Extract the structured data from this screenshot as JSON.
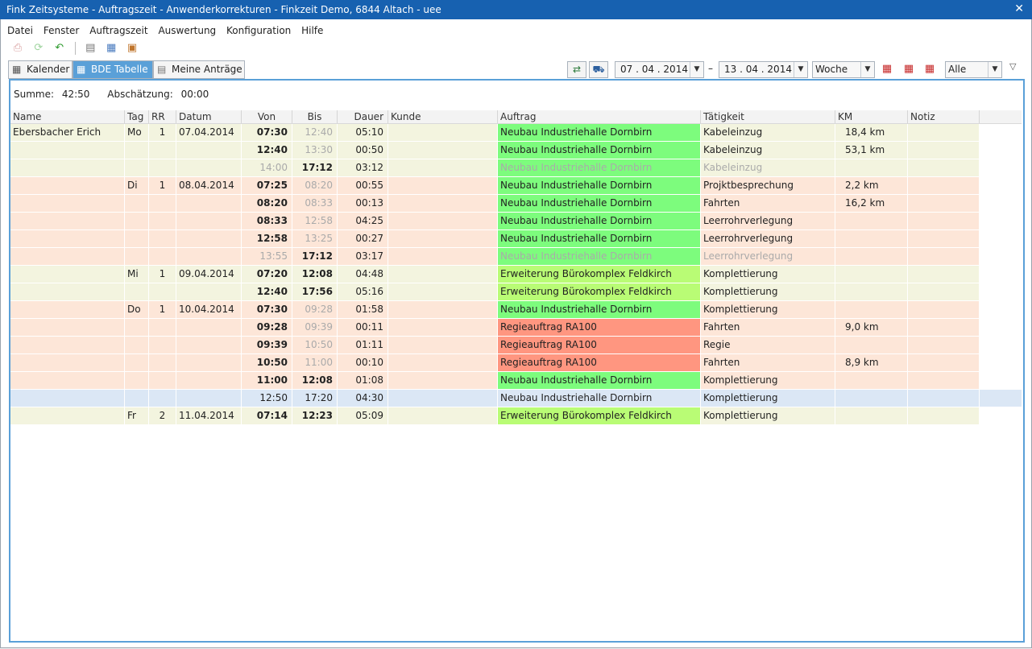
{
  "window": {
    "title": "Fink Zeitsysteme - Auftragszeit - Anwenderkorrekturen - Finkzeit Demo, 6844 Altach - uee",
    "close": "✕"
  },
  "menu": [
    "Datei",
    "Fenster",
    "Auftragszeit",
    "Auswertung",
    "Konfiguration",
    "Hilfe"
  ],
  "tabs": [
    {
      "label": "Kalender",
      "icon": "calendar-icon"
    },
    {
      "label": "BDE Tabelle",
      "icon": "table-icon"
    },
    {
      "label": "Meine Anträge",
      "icon": "document-icon"
    }
  ],
  "filter": {
    "date_from": "07 . 04 . 2014",
    "range_sep": "–",
    "date_to": "13 . 04 . 2014",
    "period": "Woche",
    "scope": "Alle"
  },
  "summary": {
    "sum_label": "Summe:",
    "sum_value": "42:50",
    "est_label": "Abschätzung:",
    "est_value": "00:00"
  },
  "columns": [
    "Name",
    "Tag",
    "RR",
    "Datum",
    "Von",
    "Bis",
    "Dauer",
    "Kunde",
    "Auftrag",
    "Tätigkeit",
    "KM",
    "Notiz"
  ],
  "colors": {
    "day_light": "#f3f4df",
    "day_peach": "#fde6d8",
    "order_green": "#7dfc7d",
    "order_lime": "#b9fc75",
    "order_red": "#ff9680",
    "selected": "#dbe7f5",
    "accent": "#5aa0d8"
  },
  "rows": [
    {
      "name": "Ebersbacher Erich",
      "tag": "Mo",
      "rr": "1",
      "datum": "07.04.2014",
      "von": "07:30",
      "bis": "12:40",
      "dauer": "05:10",
      "kunde": "",
      "auftrag": "Neubau Industriehalle Dornbirn",
      "taetigkeit": "Kabeleinzug",
      "km": "18,4 km",
      "notiz": "",
      "band": "light",
      "ac": "green",
      "vs": "b",
      "bs": "g",
      "fade": false
    },
    {
      "name": "",
      "tag": "",
      "rr": "",
      "datum": "",
      "von": "12:40",
      "bis": "13:30",
      "dauer": "00:50",
      "kunde": "",
      "auftrag": "Neubau Industriehalle Dornbirn",
      "taetigkeit": "Kabeleinzug",
      "km": "53,1 km",
      "notiz": "",
      "band": "light",
      "ac": "green",
      "vs": "b",
      "bs": "g",
      "fade": false
    },
    {
      "name": "",
      "tag": "",
      "rr": "",
      "datum": "",
      "von": "14:00",
      "bis": "17:12",
      "dauer": "03:12",
      "kunde": "",
      "auftrag": "Neubau Industriehalle Dornbirn",
      "taetigkeit": "Kabeleinzug",
      "km": "",
      "notiz": "",
      "band": "light",
      "ac": "green",
      "vs": "g",
      "bs": "b",
      "fade": true
    },
    {
      "name": "",
      "tag": "Di",
      "rr": "1",
      "datum": "08.04.2014",
      "von": "07:25",
      "bis": "08:20",
      "dauer": "00:55",
      "kunde": "",
      "auftrag": "Neubau Industriehalle Dornbirn",
      "taetigkeit": "Projktbesprechung",
      "km": "2,2 km",
      "notiz": "",
      "band": "peach",
      "ac": "green",
      "vs": "b",
      "bs": "g",
      "fade": false
    },
    {
      "name": "",
      "tag": "",
      "rr": "",
      "datum": "",
      "von": "08:20",
      "bis": "08:33",
      "dauer": "00:13",
      "kunde": "",
      "auftrag": "Neubau Industriehalle Dornbirn",
      "taetigkeit": "Fahrten",
      "km": "16,2 km",
      "notiz": "",
      "band": "peach",
      "ac": "green",
      "vs": "b",
      "bs": "g",
      "fade": false
    },
    {
      "name": "",
      "tag": "",
      "rr": "",
      "datum": "",
      "von": "08:33",
      "bis": "12:58",
      "dauer": "04:25",
      "kunde": "",
      "auftrag": "Neubau Industriehalle Dornbirn",
      "taetigkeit": "Leerrohrverlegung",
      "km": "",
      "notiz": "",
      "band": "peach",
      "ac": "green",
      "vs": "b",
      "bs": "g",
      "fade": false
    },
    {
      "name": "",
      "tag": "",
      "rr": "",
      "datum": "",
      "von": "12:58",
      "bis": "13:25",
      "dauer": "00:27",
      "kunde": "",
      "auftrag": "Neubau Industriehalle Dornbirn",
      "taetigkeit": "Leerrohrverlegung",
      "km": "",
      "notiz": "",
      "band": "peach",
      "ac": "green",
      "vs": "b",
      "bs": "g",
      "fade": false
    },
    {
      "name": "",
      "tag": "",
      "rr": "",
      "datum": "",
      "von": "13:55",
      "bis": "17:12",
      "dauer": "03:17",
      "kunde": "",
      "auftrag": "Neubau Industriehalle Dornbirn",
      "taetigkeit": "Leerrohrverlegung",
      "km": "",
      "notiz": "",
      "band": "peach",
      "ac": "green",
      "vs": "g",
      "bs": "b",
      "fade": true
    },
    {
      "name": "",
      "tag": "Mi",
      "rr": "1",
      "datum": "09.04.2014",
      "von": "07:20",
      "bis": "12:08",
      "dauer": "04:48",
      "kunde": "",
      "auftrag": "Erweiterung Bürokomplex Feldkirch",
      "taetigkeit": "Komplettierung",
      "km": "",
      "notiz": "",
      "band": "light",
      "ac": "lime",
      "vs": "b",
      "bs": "b",
      "fade": false
    },
    {
      "name": "",
      "tag": "",
      "rr": "",
      "datum": "",
      "von": "12:40",
      "bis": "17:56",
      "dauer": "05:16",
      "kunde": "",
      "auftrag": "Erweiterung Bürokomplex Feldkirch",
      "taetigkeit": "Komplettierung",
      "km": "",
      "notiz": "",
      "band": "light",
      "ac": "lime",
      "vs": "b",
      "bs": "b",
      "fade": false
    },
    {
      "name": "",
      "tag": "Do",
      "rr": "1",
      "datum": "10.04.2014",
      "von": "07:30",
      "bis": "09:28",
      "dauer": "01:58",
      "kunde": "",
      "auftrag": "Neubau Industriehalle Dornbirn",
      "taetigkeit": "Komplettierung",
      "km": "",
      "notiz": "",
      "band": "peach",
      "ac": "green",
      "vs": "b",
      "bs": "g",
      "fade": false
    },
    {
      "name": "",
      "tag": "",
      "rr": "",
      "datum": "",
      "von": "09:28",
      "bis": "09:39",
      "dauer": "00:11",
      "kunde": "",
      "auftrag": "Regieauftrag RA100",
      "taetigkeit": "Fahrten",
      "km": "9,0 km",
      "notiz": "",
      "band": "peach",
      "ac": "red",
      "vs": "b",
      "bs": "g",
      "fade": false
    },
    {
      "name": "",
      "tag": "",
      "rr": "",
      "datum": "",
      "von": "09:39",
      "bis": "10:50",
      "dauer": "01:11",
      "kunde": "",
      "auftrag": "Regieauftrag RA100",
      "taetigkeit": "Regie",
      "km": "",
      "notiz": "",
      "band": "peach",
      "ac": "red",
      "vs": "b",
      "bs": "g",
      "fade": false
    },
    {
      "name": "",
      "tag": "",
      "rr": "",
      "datum": "",
      "von": "10:50",
      "bis": "11:00",
      "dauer": "00:10",
      "kunde": "",
      "auftrag": "Regieauftrag RA100",
      "taetigkeit": "Fahrten",
      "km": "8,9 km",
      "notiz": "",
      "band": "peach",
      "ac": "red",
      "vs": "b",
      "bs": "g",
      "fade": false
    },
    {
      "name": "",
      "tag": "",
      "rr": "",
      "datum": "",
      "von": "11:00",
      "bis": "12:08",
      "dauer": "01:08",
      "kunde": "",
      "auftrag": "Neubau Industriehalle Dornbirn",
      "taetigkeit": "Komplettierung",
      "km": "",
      "notiz": "",
      "band": "peach",
      "ac": "green",
      "vs": "b",
      "bs": "b",
      "fade": false
    },
    {
      "name": "",
      "tag": "",
      "rr": "",
      "datum": "",
      "von": "12:50",
      "bis": "17:20",
      "dauer": "04:30",
      "kunde": "",
      "auftrag": "Neubau Industriehalle Dornbirn",
      "taetigkeit": "Komplettierung",
      "km": "",
      "notiz": "",
      "band": "sel",
      "ac": "none",
      "vs": "n",
      "bs": "n",
      "fade": false
    },
    {
      "name": "",
      "tag": "Fr",
      "rr": "2",
      "datum": "11.04.2014",
      "von": "07:14",
      "bis": "12:23",
      "dauer": "05:09",
      "kunde": "",
      "auftrag": "Erweiterung Bürokomplex Feldkirch",
      "taetigkeit": "Komplettierung",
      "km": "",
      "notiz": "",
      "band": "light",
      "ac": "lime",
      "vs": "b",
      "bs": "b",
      "fade": false
    }
  ]
}
